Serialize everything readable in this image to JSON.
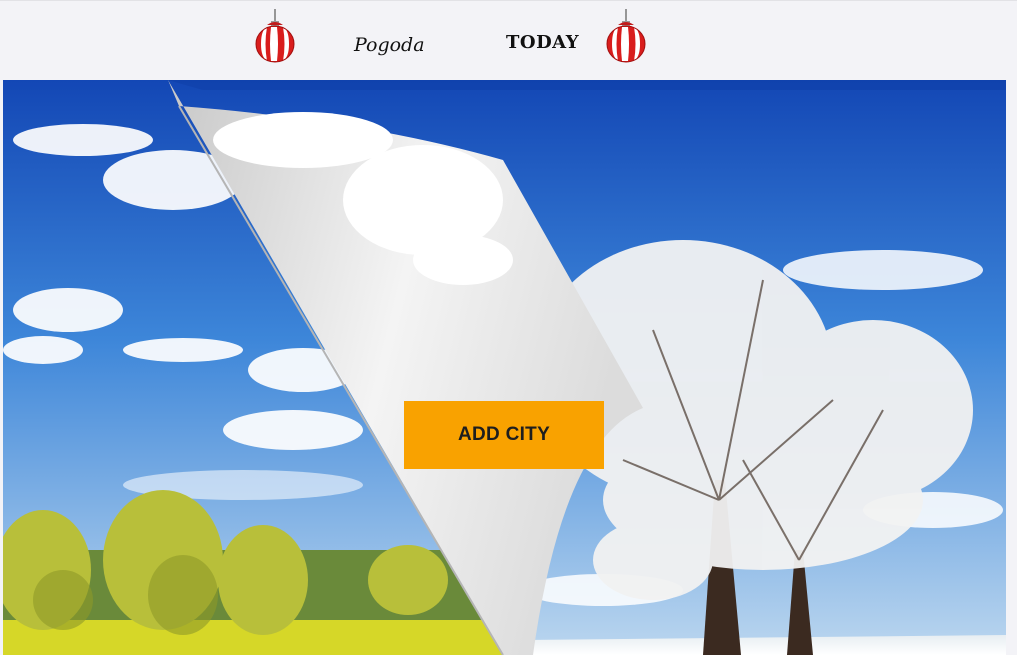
{
  "header": {
    "nav": [
      {
        "label": "Pogoda"
      },
      {
        "label": "TODAY"
      }
    ],
    "ornament_icon": "christmas-bauble-icon"
  },
  "hero": {
    "background": "page-curl-summer-winter-landscape",
    "cta_label": "ADD CITY"
  },
  "colors": {
    "topbar_bg": "#f3f3f7",
    "cta_bg": "#f9a200",
    "sky_blue": "#1a5cc8",
    "ornament_red": "#d91d1d"
  }
}
